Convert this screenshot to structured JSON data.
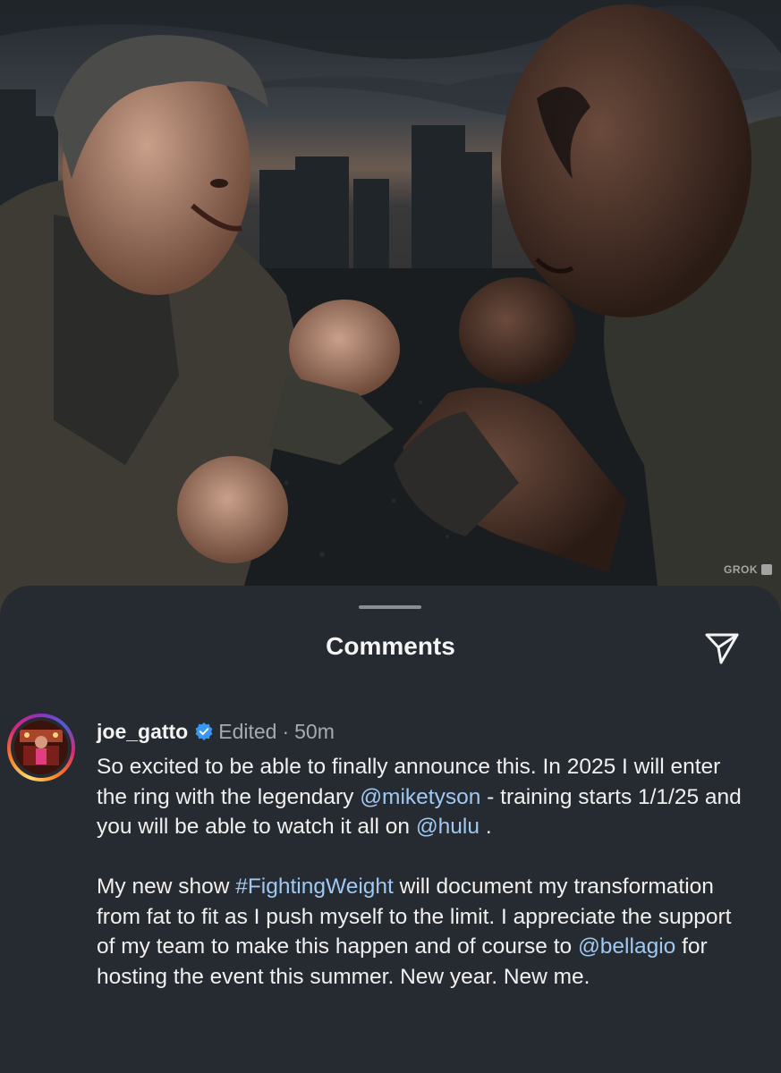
{
  "post_image": {
    "watermark": "GROK"
  },
  "sheet": {
    "title": "Comments",
    "share_icon": "paper-plane-icon"
  },
  "comment": {
    "username": "joe_gatto",
    "verified_icon": "verified-badge-icon",
    "edited_label": "Edited",
    "separator": "·",
    "time": "50m",
    "paragraph1": [
      {
        "text": "So excited to be able to finally announce this. In 2025 I will enter the ring with the legendary ",
        "link": false
      },
      {
        "text": "@miketyson",
        "link": true
      },
      {
        "text": " - training starts 1/1/25 and you will be able to watch it all on ",
        "link": false
      },
      {
        "text": "@hulu",
        "link": true
      },
      {
        "text": " .",
        "link": false
      }
    ],
    "paragraph2": [
      {
        "text": "My new show ",
        "link": false
      },
      {
        "text": "#FightingWeight",
        "link": true
      },
      {
        "text": " will document my transformation from fat to fit as I push myself to the limit. I appreciate the support of my team to make this happen and of course to ",
        "link": false
      },
      {
        "text": "@bellagio",
        "link": true
      },
      {
        "text": " for hosting the event this summer. New year. New me.",
        "link": false
      }
    ]
  },
  "colors": {
    "sheet_bg": "#262a31",
    "link": "#9fc9f2",
    "muted": "#a7aab0",
    "verified": "#3897f0"
  }
}
